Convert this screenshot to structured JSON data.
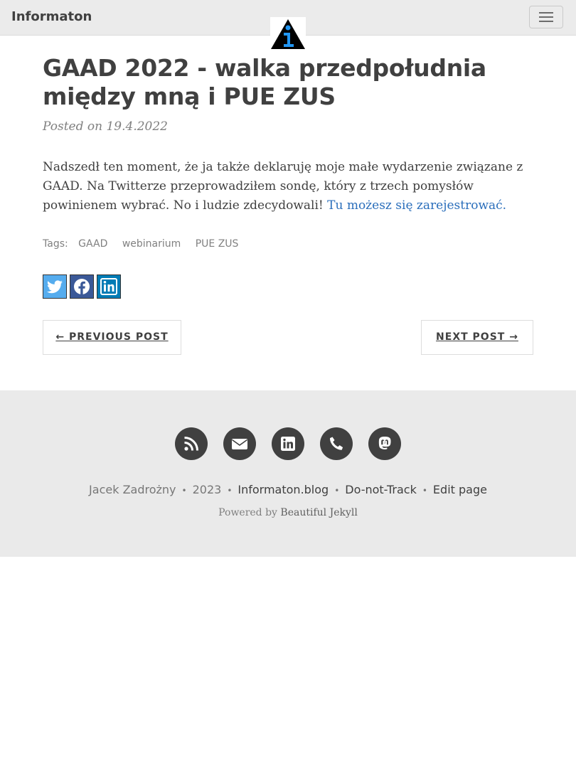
{
  "navbar": {
    "brand": "Informaton",
    "menu_toggle_icon": "hamburger-icon",
    "logo_icon": "info-logo-icon"
  },
  "post": {
    "title": "GAAD 2022 - walka przedpołudnia między mną i PUE ZUS",
    "meta": "Posted on 19.4.2022",
    "body_text": "Nadszedł ten moment, że ja także deklaruję moje małe wydarzenie związane z GAAD. Na Twitterze przeprowadziłem sondę, który z trzech pomysłów powinienem wybrać. No i ludzie zdecydowali!",
    "body_link": "Tu możesz się zarejestrować."
  },
  "tags": {
    "label": "Tags:",
    "items": [
      "GAAD",
      "webinarium",
      "PUE ZUS"
    ]
  },
  "share": {
    "icons": [
      "twitter-icon",
      "facebook-icon",
      "linkedin-icon"
    ],
    "colors": {
      "twitter": "#55acee",
      "facebook": "#3b5998",
      "linkedin": "#007bb5"
    }
  },
  "pager": {
    "previous": "← PREVIOUS POST",
    "next": "NEXT POST →"
  },
  "footer": {
    "social_icons": [
      "rss-icon",
      "email-icon",
      "linkedin-icon",
      "phone-icon",
      "mastodon-icon"
    ],
    "author": "Jacek Zadrożny",
    "year": "2023",
    "site": "Informaton.blog",
    "dnt": "Do-not-Track",
    "edit": "Edit page",
    "powered_prefix": "Powered by",
    "powered_link": "Beautiful Jekyll"
  }
}
